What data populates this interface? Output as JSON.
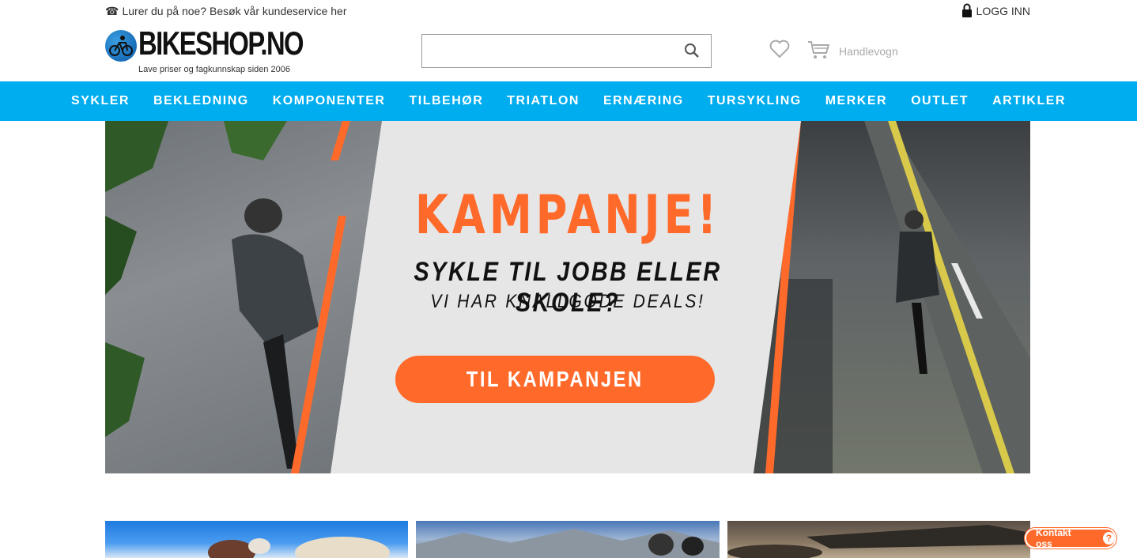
{
  "topbar": {
    "phone_icon": "☎",
    "service_text": "Lurer du på noe? Besøk vår kundeservice her",
    "login_label": "LOGG INN"
  },
  "header": {
    "logo_text": "BIKESHOP.NO",
    "logo_tagline": "Lave priser og fagkunnskap siden 2006",
    "search_value": "",
    "cart_label": "Handlevogn"
  },
  "nav": {
    "items": [
      {
        "label": "SYKLER"
      },
      {
        "label": "BEKLEDNING"
      },
      {
        "label": "KOMPONENTER"
      },
      {
        "label": "TILBEHØR"
      },
      {
        "label": "TRIATLON"
      },
      {
        "label": "ERNÆRING"
      },
      {
        "label": "TURSYKLING"
      },
      {
        "label": "MERKER"
      },
      {
        "label": "OUTLET"
      },
      {
        "label": "ARTIKLER"
      }
    ]
  },
  "hero": {
    "title": "KAMPANJE!",
    "subtitle": "SYKLE TIL JOBB ELLER SKOLE?",
    "subtitle2": "VI HAR KNALLGODE DEALS!",
    "button_label": "TIL KAMPANJEN"
  },
  "contact": {
    "label": "Kontakt oss",
    "icon": "?"
  },
  "colors": {
    "nav_bg": "#00adef",
    "accent": "#ff6a2b"
  }
}
